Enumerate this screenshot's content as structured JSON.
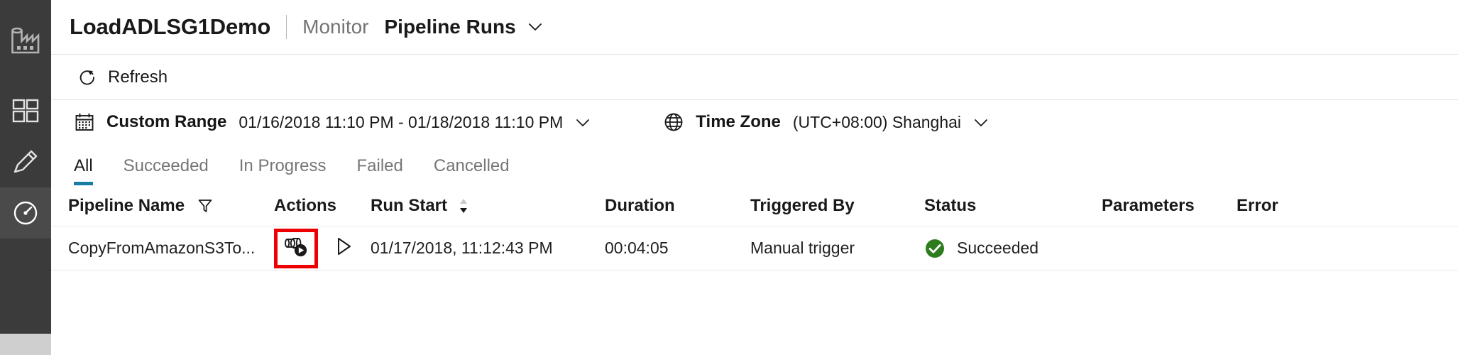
{
  "sidebar": {
    "logo_icon": "data-factory-logo-icon",
    "items": [
      {
        "icon": "author-grid-icon",
        "name": "author",
        "active": false
      },
      {
        "icon": "pencil-edit-icon",
        "name": "edit",
        "active": false
      },
      {
        "icon": "gauge-monitor-icon",
        "name": "monitor",
        "active": true
      }
    ]
  },
  "header": {
    "title": "LoadADLSG1Demo",
    "breadcrumb_parent": "Monitor",
    "breadcrumb_current": "Pipeline Runs",
    "chevron_icon": "chevron-down-icon"
  },
  "toolbar": {
    "refresh_label": "Refresh",
    "refresh_icon": "refresh-icon"
  },
  "filterbar": {
    "range_icon": "calendar-icon",
    "range_label": "Custom Range",
    "range_value": "01/16/2018 11:10 PM - 01/18/2018 11:10 PM",
    "timezone_icon": "globe-icon",
    "timezone_label": "Time Zone",
    "timezone_value": "(UTC+08:00) Shanghai",
    "chevron_icon": "chevron-down-icon"
  },
  "tabs": [
    {
      "label": "All",
      "active": true
    },
    {
      "label": "Succeeded",
      "active": false
    },
    {
      "label": "In Progress",
      "active": false
    },
    {
      "label": "Failed",
      "active": false
    },
    {
      "label": "Cancelled",
      "active": false
    }
  ],
  "table": {
    "columns": [
      {
        "label": "Pipeline Name",
        "icon": "filter-funnel-icon"
      },
      {
        "label": "Actions",
        "icon": ""
      },
      {
        "label": "Run Start",
        "icon": "sort-descending-icon"
      },
      {
        "label": "Duration",
        "icon": ""
      },
      {
        "label": "Triggered By",
        "icon": ""
      },
      {
        "label": "Status",
        "icon": ""
      },
      {
        "label": "Parameters",
        "icon": ""
      },
      {
        "label": "Error",
        "icon": ""
      }
    ],
    "rows": [
      {
        "pipeline_name": "CopyFromAmazonS3To...",
        "action_view_icon": "view-activity-runs-icon",
        "action_rerun_icon": "rerun-triangle-icon",
        "run_start": "01/17/2018, 11:12:43 PM",
        "duration": "00:04:05",
        "triggered_by": "Manual trigger",
        "status": "Succeeded",
        "status_icon": "success-check-icon",
        "parameters": "",
        "error": ""
      }
    ]
  },
  "annotation": {
    "highlight_color": "#ef0000",
    "target": "view-activity-runs-icon"
  },
  "colors": {
    "sidebar_bg": "#3b3b3b",
    "accent": "#197ca5",
    "success": "#2d7d1f",
    "highlight": "#ef0000"
  }
}
